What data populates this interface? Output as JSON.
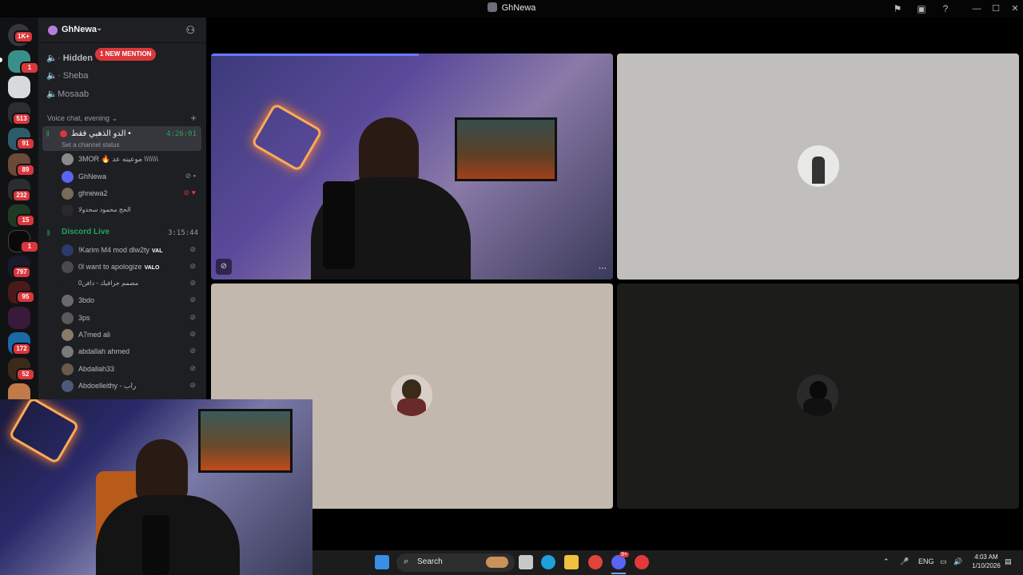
{
  "window": {
    "title": "GhNewa"
  },
  "servers": {
    "home_badge": "1K+",
    "badges": [
      "1",
      "513",
      "91",
      "89",
      "232",
      "15",
      "1",
      "797",
      "95",
      "172",
      "52"
    ]
  },
  "guild": {
    "name": "GhNewa"
  },
  "channels": {
    "mention_pill": "1 NEW MENTION",
    "items": [
      "Hidden",
      "Sheba",
      "Mosaab"
    ]
  },
  "category": {
    "label": "Voice chat, evening"
  },
  "voice_active": {
    "name": "الدو الذهبي فقط •",
    "time": "4:26:01",
    "status": "Set a channel status"
  },
  "voice_members_1": [
    {
      "name": "3MOR 🔥 موعينه عد \\\\\\\\\\\\\\"
    },
    {
      "name": "GhNewa"
    },
    {
      "name": "ghnewa2"
    },
    {
      "name": "الحج محمود سحدولا"
    }
  ],
  "voice_channel_2": {
    "name": "Discord Live",
    "time": "3:15:44"
  },
  "voice_members_2": [
    {
      "name": "!Karim M4 mod dlw2ty",
      "tag": "VAL"
    },
    {
      "name": "0l want to apologize",
      "tag": "VALO"
    },
    {
      "name": "0مصمم جرافيك - دافن",
      "tag": ""
    },
    {
      "name": "3bdo",
      "tag": ""
    },
    {
      "name": "3ps",
      "tag": ""
    },
    {
      "name": "A7med ali",
      "tag": ""
    },
    {
      "name": "abdallah ahmed",
      "tag": ""
    },
    {
      "name": "Abdallah33",
      "tag": ""
    },
    {
      "name": "Abdoelleithy - راب",
      "tag": ""
    }
  ],
  "taskbar": {
    "search_label": "Search",
    "chat_badge": "9+",
    "lang": "ENG",
    "time": "4:03 AM",
    "date": "1/10/2026"
  },
  "colors": {
    "accent_green": "#23a55a",
    "mention_red": "#da373c",
    "tile_light": "#c0bfbb",
    "tile_beige": "#c2b8ad",
    "tile_dark": "#1c1c1a"
  }
}
